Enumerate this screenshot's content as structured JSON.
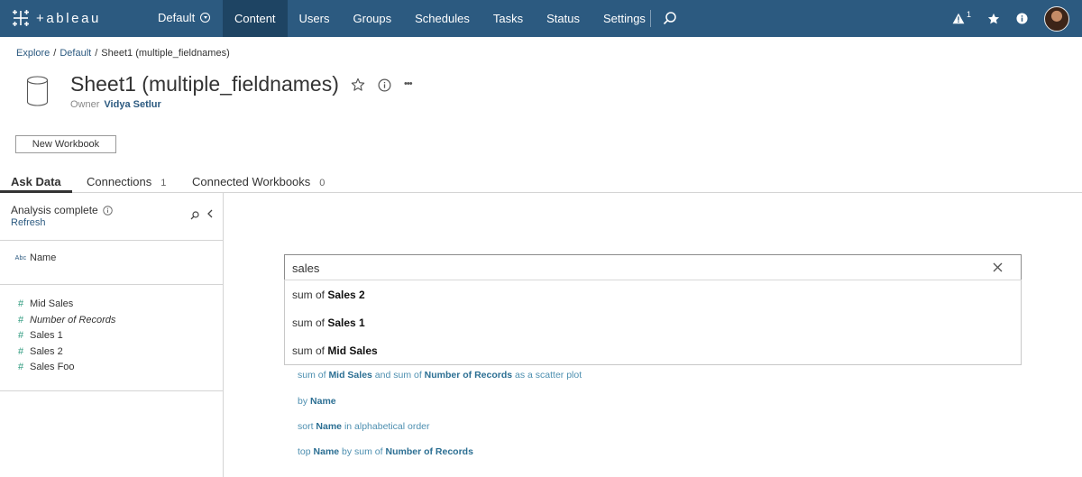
{
  "nav": {
    "logo_text": "+ableau",
    "site": "Default",
    "items": [
      {
        "label": "Content",
        "active": true
      },
      {
        "label": "Users",
        "active": false
      },
      {
        "label": "Groups",
        "active": false
      },
      {
        "label": "Schedules",
        "active": false
      },
      {
        "label": "Tasks",
        "active": false
      },
      {
        "label": "Status",
        "active": false
      },
      {
        "label": "Settings",
        "active": false
      }
    ],
    "alert_count": "1"
  },
  "breadcrumb": {
    "explore": "Explore",
    "sep1": "/",
    "site": "Default",
    "sep2": "/",
    "current": "Sheet1 (multiple_fieldnames)"
  },
  "header": {
    "title": "Sheet1 (multiple_fieldnames)",
    "owner_label": "Owner",
    "owner_name": "Vidya Setlur",
    "more": "•••"
  },
  "new_workbook_button": "New Workbook",
  "tabs": {
    "ask_data": "Ask Data",
    "connections": "Connections",
    "connections_count": "1",
    "connected_workbooks": "Connected Workbooks",
    "connected_workbooks_count": "0"
  },
  "left_panel": {
    "status": "Analysis complete",
    "refresh": "Refresh",
    "dimension_icon": "Abc",
    "dimensions": [
      "Name"
    ],
    "measure_icon": "#",
    "measures": [
      {
        "label": "Mid Sales",
        "italic": false
      },
      {
        "label": "Number of Records",
        "italic": true
      },
      {
        "label": "Sales 1",
        "italic": false
      },
      {
        "label": "Sales 2",
        "italic": false
      },
      {
        "label": "Sales Foo",
        "italic": false
      }
    ]
  },
  "search": {
    "value": "sales",
    "dropdown": [
      {
        "prefix": "sum of ",
        "bold": "Sales 2"
      },
      {
        "prefix": "sum of ",
        "bold": "Sales 1"
      },
      {
        "prefix": "sum of ",
        "bold": "Mid Sales"
      }
    ]
  },
  "suggestions": [
    {
      "p1": "sum of ",
      "b1": "Mid Sales",
      "p2": " and sum of ",
      "b2": "Number of Records",
      "p3": " as a scatter plot"
    },
    {
      "p1": "by ",
      "b1": "Name",
      "p2": "",
      "b2": "",
      "p3": ""
    },
    {
      "p1": "sort ",
      "b1": "Name",
      "p2": " in alphabetical order",
      "b2": "",
      "p3": ""
    },
    {
      "p1": "top ",
      "b1": "Name",
      "p2": " by sum of ",
      "b2": "Number of Records",
      "p3": ""
    }
  ]
}
